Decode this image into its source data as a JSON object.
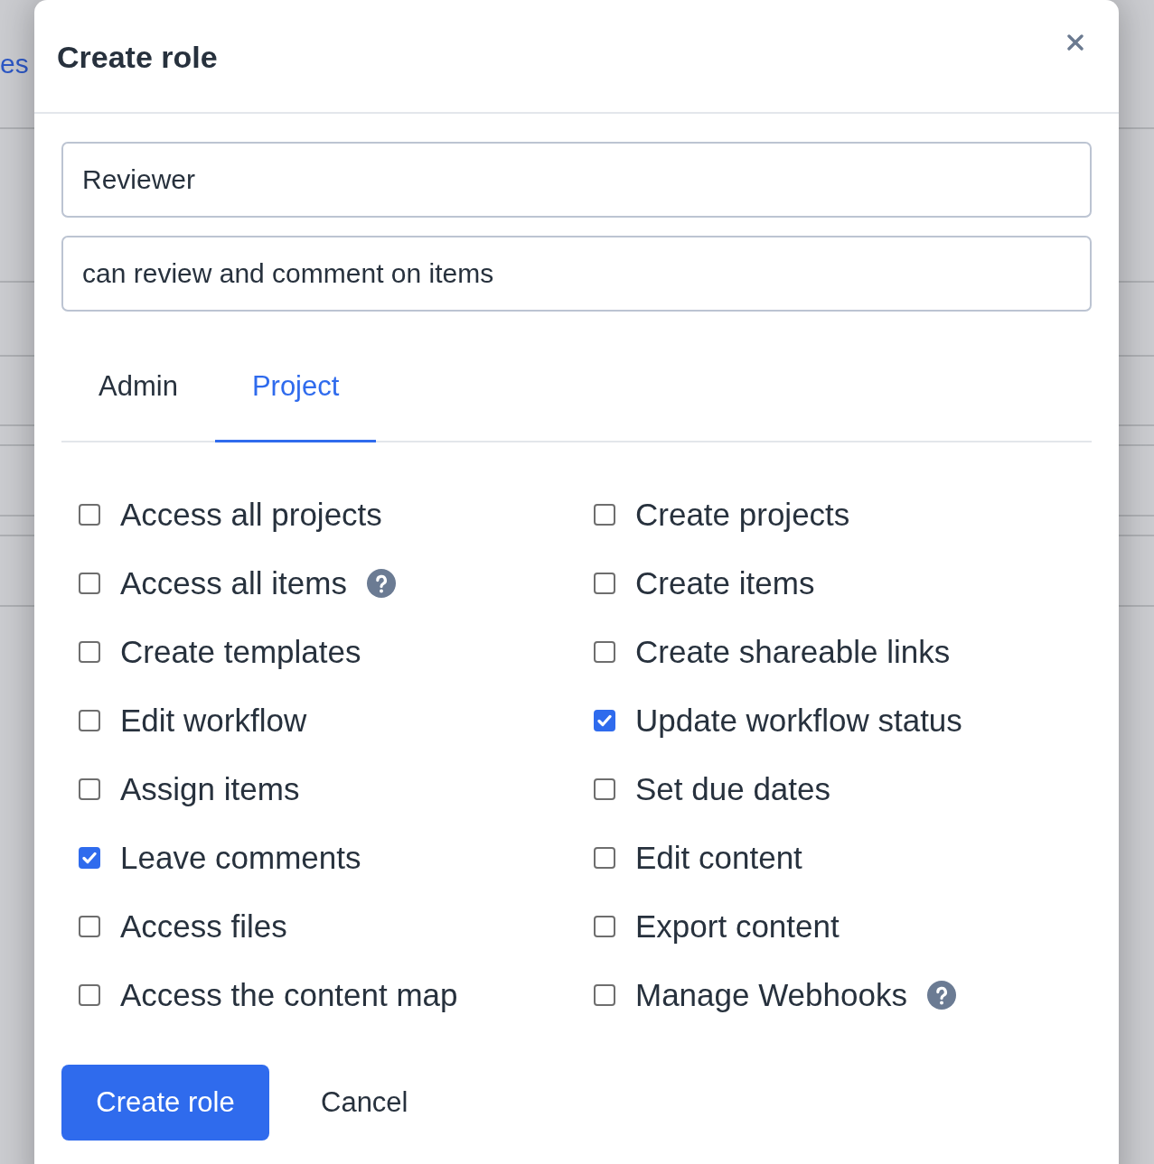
{
  "background": {
    "link_text": "es"
  },
  "dialog": {
    "title": "Create role",
    "name_field": {
      "value": "Reviewer"
    },
    "description_field": {
      "value": "can review and comment on items"
    },
    "tabs": [
      {
        "label": "Admin",
        "selected": false
      },
      {
        "label": "Project",
        "selected": true
      }
    ],
    "permissions": [
      {
        "label": "Access all projects",
        "checked": false,
        "help": false
      },
      {
        "label": "Create projects",
        "checked": false,
        "help": false
      },
      {
        "label": "Access all items",
        "checked": false,
        "help": true
      },
      {
        "label": "Create items",
        "checked": false,
        "help": false
      },
      {
        "label": "Create templates",
        "checked": false,
        "help": false
      },
      {
        "label": "Create shareable links",
        "checked": false,
        "help": false
      },
      {
        "label": "Edit workflow",
        "checked": false,
        "help": false
      },
      {
        "label": "Update workflow status",
        "checked": true,
        "help": false
      },
      {
        "label": "Assign items",
        "checked": false,
        "help": false
      },
      {
        "label": "Set due dates",
        "checked": false,
        "help": false
      },
      {
        "label": "Leave comments",
        "checked": true,
        "help": false
      },
      {
        "label": "Edit content",
        "checked": false,
        "help": false
      },
      {
        "label": "Access files",
        "checked": false,
        "help": false
      },
      {
        "label": "Export content",
        "checked": false,
        "help": false
      },
      {
        "label": "Access the content map",
        "checked": false,
        "help": false
      },
      {
        "label": "Manage Webhooks",
        "checked": false,
        "help": true
      }
    ],
    "actions": [
      {
        "label": "Create role",
        "kind": "primary"
      },
      {
        "label": "Cancel",
        "kind": "secondary"
      }
    ]
  }
}
